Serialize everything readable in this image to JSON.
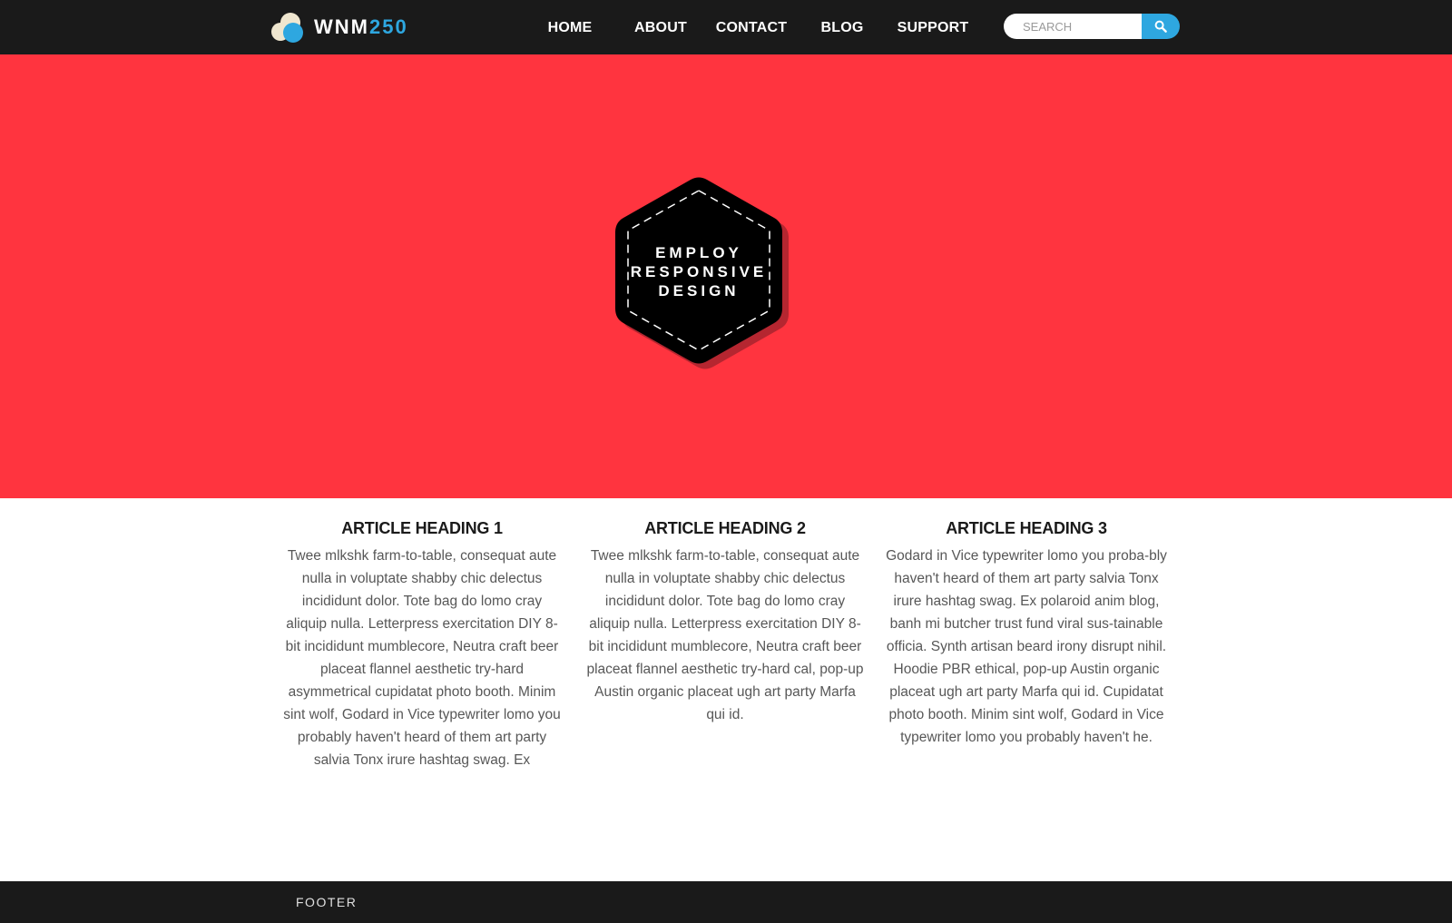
{
  "brand": {
    "name_prefix": "WNM",
    "name_suffix": "250",
    "accent_color": "#2ea7e0"
  },
  "nav": {
    "items": [
      {
        "label": "HOME"
      },
      {
        "label": "ABOUT"
      },
      {
        "label": "CONTACT"
      },
      {
        "label": "BLOG"
      },
      {
        "label": "SUPPORT"
      }
    ]
  },
  "search": {
    "placeholder": "SEARCH",
    "value": "",
    "button_icon": "search-icon"
  },
  "hero": {
    "background_color": "#ff343f",
    "badge": {
      "lines": [
        "EMPLOY",
        "RESPONSIVE",
        "DESIGN"
      ]
    }
  },
  "articles": [
    {
      "heading": "ARTICLE HEADING 1",
      "body": "Twee mlkshk farm-to-table, consequat aute nulla in voluptate shabby chic delectus incididunt dolor. Tote bag do lomo cray aliquip nulla. Letterpress exercitation DIY 8-bit incididunt mumblecore, Neutra craft beer placeat flannel aesthetic try-hard asymmetrical cupidatat photo booth. Minim sint wolf, Godard in Vice typewriter lomo you probably haven't heard of them art party salvia Tonx irure hashtag swag. Ex"
    },
    {
      "heading": "ARTICLE HEADING 2",
      "body": "Twee mlkshk farm-to-table, consequat aute nulla in voluptate shabby chic delectus incididunt dolor. Tote bag do lomo cray aliquip nulla. Letterpress exercitation DIY 8-bit incididunt mumblecore, Neutra craft beer placeat flannel aesthetic try-hard cal, pop-up Austin organic placeat ugh art party Marfa qui id."
    },
    {
      "heading": "ARTICLE HEADING 3",
      "body": "Godard in Vice typewriter lomo you proba-bly haven't heard of them art party salvia Tonx irure hashtag swag. Ex polaroid anim blog, banh mi butcher trust fund viral sus-tainable officia. Synth artisan beard irony disrupt nihil. Hoodie PBR ethical, pop-up Austin organic placeat ugh art party Marfa qui id. Cupidatat photo booth. Minim sint wolf, Godard in Vice typewriter lomo you probably haven't he."
    }
  ],
  "footer": {
    "label": "FOOTER"
  }
}
